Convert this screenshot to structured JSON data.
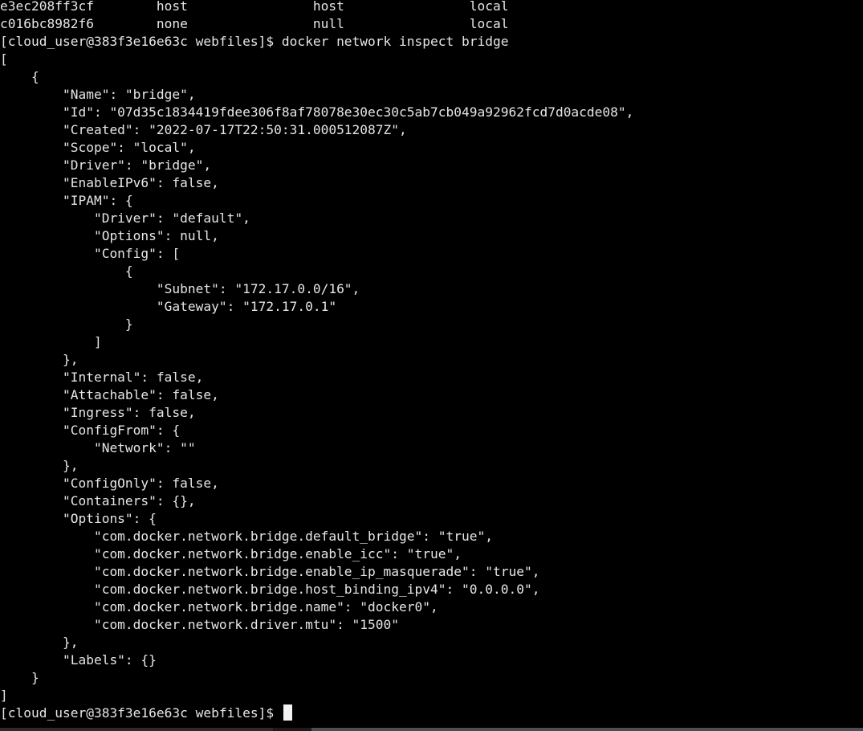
{
  "terminal": {
    "lines": [
      "e3ec208ff3cf        host                host                local",
      "c016bc8982f6        none                null                local",
      "[cloud_user@383f3e16e63c webfiles]$ docker network inspect bridge",
      "[",
      "    {",
      "        \"Name\": \"bridge\",",
      "        \"Id\": \"07d35c1834419fdee306f8af78078e30ec30c5ab7cb049a92962fcd7d0acde08\",",
      "        \"Created\": \"2022-07-17T22:50:31.000512087Z\",",
      "        \"Scope\": \"local\",",
      "        \"Driver\": \"bridge\",",
      "        \"EnableIPv6\": false,",
      "        \"IPAM\": {",
      "            \"Driver\": \"default\",",
      "            \"Options\": null,",
      "            \"Config\": [",
      "                {",
      "                    \"Subnet\": \"172.17.0.0/16\",",
      "                    \"Gateway\": \"172.17.0.1\"",
      "                }",
      "            ]",
      "        },",
      "        \"Internal\": false,",
      "        \"Attachable\": false,",
      "        \"Ingress\": false,",
      "        \"ConfigFrom\": {",
      "            \"Network\": \"\"",
      "        },",
      "        \"ConfigOnly\": false,",
      "        \"Containers\": {},",
      "        \"Options\": {",
      "            \"com.docker.network.bridge.default_bridge\": \"true\",",
      "            \"com.docker.network.bridge.enable_icc\": \"true\",",
      "            \"com.docker.network.bridge.enable_ip_masquerade\": \"true\",",
      "            \"com.docker.network.bridge.host_binding_ipv4\": \"0.0.0.0\",",
      "            \"com.docker.network.bridge.name\": \"docker0\",",
      "            \"com.docker.network.driver.mtu\": \"1500\"",
      "        },",
      "        \"Labels\": {}",
      "    }",
      "]"
    ],
    "prompt": "[cloud_user@383f3e16e63c webfiles]$ ",
    "input_value": ""
  },
  "colors": {
    "background": "#000000",
    "foreground": "#e6e6e6",
    "cursor": "#f2f2f2"
  }
}
